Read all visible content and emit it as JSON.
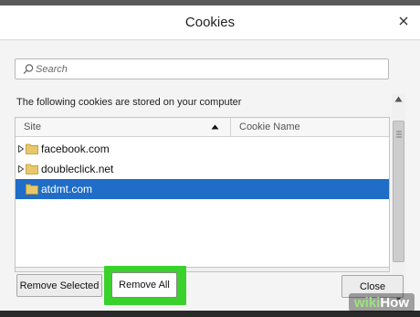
{
  "dialog": {
    "title": "Cookies"
  },
  "search": {
    "placeholder": "Search",
    "value": ""
  },
  "intro_text": "The following cookies are stored on your computer",
  "table": {
    "columns": [
      "Site",
      "Cookie Name"
    ],
    "sort_column": "Site",
    "sort_direction": "ascending",
    "rows": [
      {
        "label": "facebook.com",
        "selected": false,
        "expandable": true
      },
      {
        "label": "doubleclick.net",
        "selected": false,
        "expandable": true
      },
      {
        "label": "atdmt.com",
        "selected": true,
        "expandable": false
      }
    ]
  },
  "buttons": {
    "remove_selected": "Remove Selected",
    "remove_all": "Remove All",
    "close": "Close"
  },
  "watermark": {
    "part1": "wiki",
    "part2": "How"
  },
  "colors": {
    "selection": "#1f6dc7",
    "highlight": "#3ad12d",
    "folder": "#e8c86a"
  }
}
